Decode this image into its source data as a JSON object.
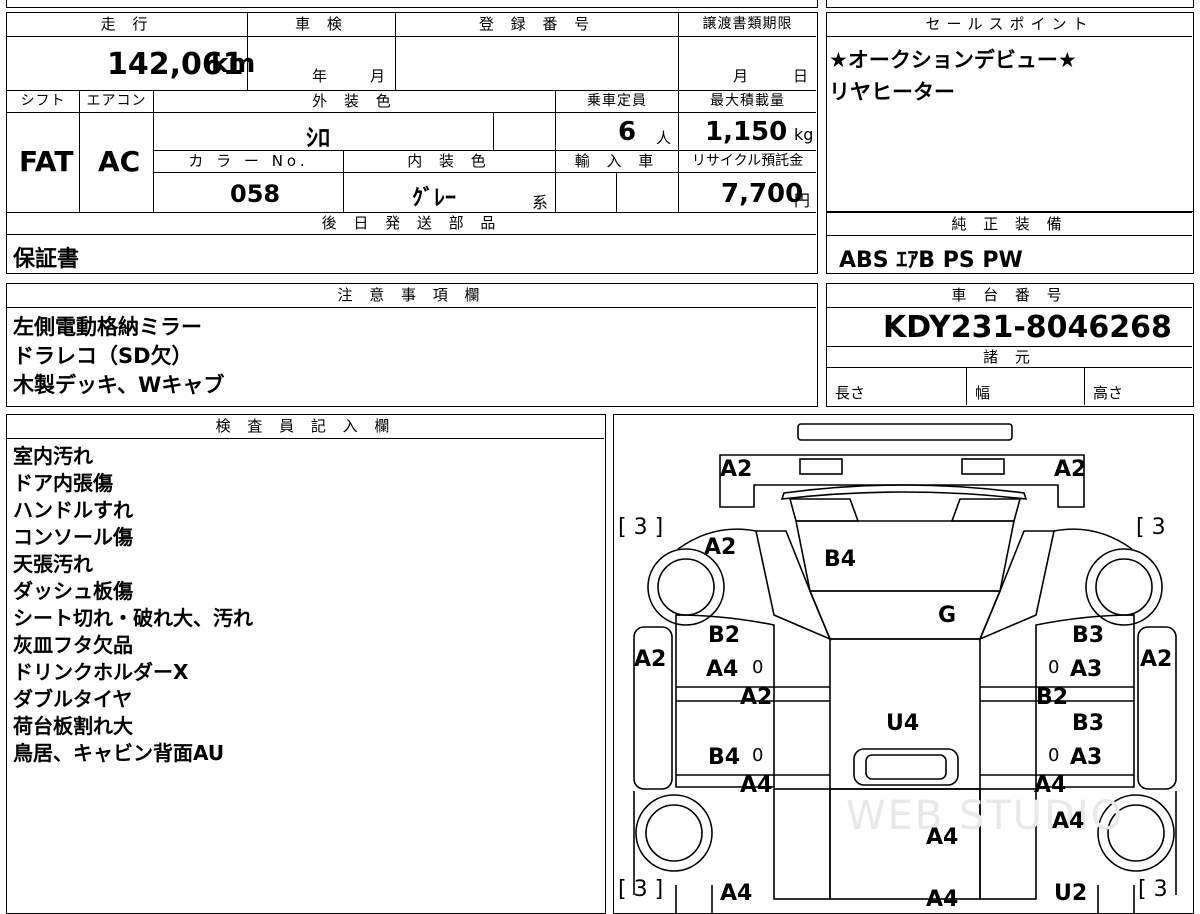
{
  "vehicle": {
    "mileage_label": "走 行",
    "mileage": "142,061",
    "mileage_unit": "km",
    "inspection_label": "車 検",
    "inspection_year": "年",
    "inspection_month": "月",
    "registration_label": "登 録 番 号",
    "transfer_deadline_label": "譲渡書類期限",
    "transfer_month": "月",
    "transfer_day": "日",
    "shift_label": "シフト",
    "shift": "FAT",
    "ac_label": "エアコン",
    "ac": "AC",
    "exterior_label": "外 装 色",
    "exterior": "ｼﾛ",
    "capacity_label": "乗車定員",
    "capacity": "6",
    "capacity_unit": "人",
    "max_load_label": "最大積載量",
    "max_load": "1,150",
    "max_load_unit": "kg",
    "color_no_label": "カ ラ ー No.",
    "color_no": "058",
    "interior_label": "内 装 色",
    "interior": "ｸﾞﾚｰ",
    "interior_suffix": "系",
    "import_label": "輸 入 車",
    "recycle_label": "リサイクル預託金",
    "recycle_fee": "7,700",
    "recycle_unit": "円",
    "later_parts_label": "後 日 発 送 部 品",
    "later_parts": "保証書",
    "notes_label": "注 意 事 項 欄",
    "notes": [
      "左側電動格納ミラー",
      "ドラレコ（SD欠）",
      "木製デッキ、Wキャブ"
    ]
  },
  "sales": {
    "label": "セールスポイント",
    "lines": [
      "★オークションデビュー★",
      "リヤヒーター"
    ]
  },
  "equipment": {
    "label": "純 正 装 備",
    "value": "ABS ｴｱB PS PW"
  },
  "chassis": {
    "label": "車 台 番 号",
    "value": "KDY231-8046268",
    "specs_label": "諸 元",
    "length_label": "長さ",
    "width_label": "幅",
    "height_label": "高さ"
  },
  "inspector": {
    "label": "検 査 員 記 入 欄",
    "lines": [
      "室内汚れ",
      "ドア内張傷",
      "ハンドルすれ",
      "コンソール傷",
      "天張汚れ",
      "ダッシュ板傷",
      "シート切れ・破れ大、汚れ",
      "灰皿フタ欠品",
      "ドリンクホルダーX",
      "ダブルタイヤ",
      "荷台板割れ大",
      "鳥居、キャビン背面AU"
    ]
  },
  "diagram": {
    "marks": {
      "a2_tl": "A2",
      "a2_tr": "A2",
      "b3_l": "[ 3 ]",
      "b3_r": "[ 3",
      "a2_fl": "A2",
      "b4_hood": "B4",
      "g_windshield": "G",
      "b2_l": "B2",
      "a4_l": "A4",
      "a2_sidel": "A2",
      "a2_mid": "A2",
      "b2_mid": "B2",
      "b3_r1": "B3",
      "a3_r1": "A3",
      "a2_sider": "A2",
      "u4_roof": "U4",
      "b3_r2": "B3",
      "a3_r2": "A3",
      "b4_l2": "B4",
      "a4_l2": "A4",
      "a4_r2": "A4",
      "a4_r3": "A4",
      "a4_bed": "A4",
      "b3_bl": "[ 3 ]",
      "a4_bl": "A4",
      "a4_bm": "A4",
      "u2_br": "U2",
      "b3_br": "[ 3",
      "zero1": "0",
      "zero2": "0",
      "zero3": "0",
      "zero4": "0"
    },
    "watermark": "WEB STUDIO"
  }
}
